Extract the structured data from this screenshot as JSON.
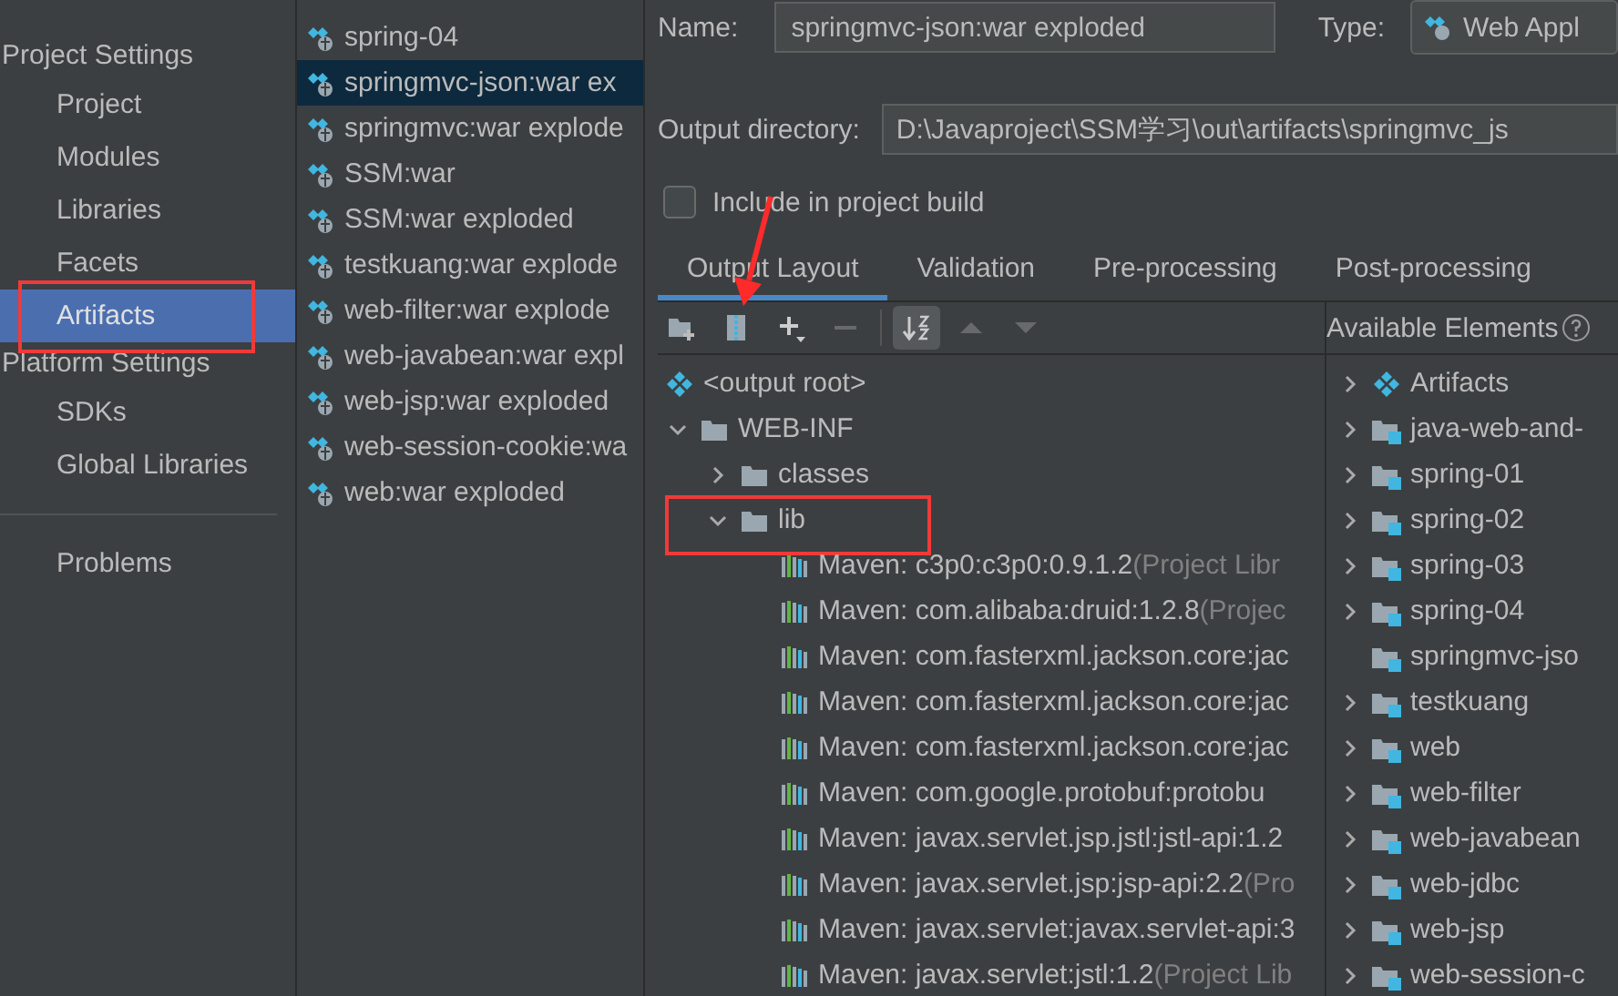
{
  "nav": [
    {
      "kind": "header",
      "label": "Project Settings"
    },
    {
      "kind": "item",
      "label": "Project",
      "selected": false,
      "highlighted": false
    },
    {
      "kind": "item",
      "label": "Modules",
      "selected": false,
      "highlighted": false
    },
    {
      "kind": "item",
      "label": "Libraries",
      "selected": false,
      "highlighted": false
    },
    {
      "kind": "item",
      "label": "Facets",
      "selected": false,
      "highlighted": false
    },
    {
      "kind": "item",
      "label": "Artifacts",
      "selected": true,
      "highlighted": true
    },
    {
      "kind": "header",
      "label": "Platform Settings"
    },
    {
      "kind": "item",
      "label": "SDKs",
      "selected": false,
      "highlighted": false
    },
    {
      "kind": "item",
      "label": "Global Libraries",
      "selected": false,
      "highlighted": false
    },
    {
      "kind": "separator"
    },
    {
      "kind": "item",
      "label": "Problems",
      "selected": false,
      "highlighted": false
    }
  ],
  "artifacts": [
    {
      "label": "spring-04",
      "selected": false
    },
    {
      "label": "springmvc-json:war ex",
      "selected": true
    },
    {
      "label": "springmvc:war explode",
      "selected": false
    },
    {
      "label": "SSM:war",
      "selected": false
    },
    {
      "label": "SSM:war exploded",
      "selected": false
    },
    {
      "label": "testkuang:war explode",
      "selected": false
    },
    {
      "label": "web-filter:war explode",
      "selected": false
    },
    {
      "label": "web-javabean:war expl",
      "selected": false
    },
    {
      "label": "web-jsp:war exploded",
      "selected": false
    },
    {
      "label": "web-session-cookie:wa",
      "selected": false
    },
    {
      "label": "web:war exploded",
      "selected": false
    }
  ],
  "name": {
    "label": "Name:",
    "value": "springmvc-json:war exploded"
  },
  "type": {
    "label": "Type:",
    "value": "Web Appl"
  },
  "output_directory": {
    "label": "Output directory:",
    "value": "D:\\Javaproject\\SSM学习\\out\\artifacts\\springmvc_js"
  },
  "include_in_build": {
    "label": "Include in project build",
    "checked": false
  },
  "tabs": [
    {
      "label": "Output Layout",
      "selected": true
    },
    {
      "label": "Validation",
      "selected": false
    },
    {
      "label": "Pre-processing",
      "selected": false
    },
    {
      "label": "Post-processing",
      "selected": false
    }
  ],
  "toolbar": [
    {
      "kind": "new-folder",
      "disabled": false,
      "on": false
    },
    {
      "kind": "archive",
      "disabled": false,
      "on": false,
      "pointed": true
    },
    {
      "kind": "add",
      "disabled": false,
      "on": false
    },
    {
      "kind": "remove",
      "disabled": true,
      "on": false
    },
    {
      "kind": "separator"
    },
    {
      "kind": "sort",
      "disabled": false,
      "on": true
    },
    {
      "kind": "up",
      "disabled": true,
      "on": false
    },
    {
      "kind": "down",
      "disabled": true,
      "on": false
    }
  ],
  "available_elements": {
    "label": "Available Elements"
  },
  "output_tree": [
    {
      "kind": "root",
      "label": "<output root>"
    },
    {
      "kind": "folder",
      "label": "WEB-INF",
      "expanded": true,
      "children": [
        {
          "kind": "folder",
          "label": "classes",
          "expanded": false
        },
        {
          "kind": "folder",
          "label": "lib",
          "expanded": true,
          "highlighted": true,
          "children": [
            {
              "kind": "library",
              "label": "Maven: c3p0:c3p0:0.9.1.2",
              "note": "(Project Libr"
            },
            {
              "kind": "library",
              "label": "Maven: com.alibaba:druid:1.2.8",
              "note": "(Projec"
            },
            {
              "kind": "library",
              "label": "Maven: com.fasterxml.jackson.core:jac"
            },
            {
              "kind": "library",
              "label": "Maven: com.fasterxml.jackson.core:jac"
            },
            {
              "kind": "library",
              "label": "Maven: com.fasterxml.jackson.core:jac"
            },
            {
              "kind": "library",
              "label": "Maven: com.google.protobuf:protobu"
            },
            {
              "kind": "library",
              "label": "Maven: javax.servlet.jsp.jstl:jstl-api:1.2"
            },
            {
              "kind": "library",
              "label": "Maven: javax.servlet.jsp:jsp-api:2.2",
              "note": "(Pro"
            },
            {
              "kind": "library",
              "label": "Maven: javax.servlet:javax.servlet-api:3"
            },
            {
              "kind": "library",
              "label": "Maven: javax.servlet:jstl:1.2",
              "note": "(Project Lib"
            }
          ]
        }
      ]
    }
  ],
  "available": [
    {
      "kind": "artifacts",
      "label": "Artifacts",
      "expandable": true
    },
    {
      "kind": "module",
      "label": "java-web-and-",
      "expandable": true
    },
    {
      "kind": "module",
      "label": "spring-01",
      "expandable": true
    },
    {
      "kind": "module",
      "label": "spring-02",
      "expandable": true
    },
    {
      "kind": "module",
      "label": "spring-03",
      "expandable": true
    },
    {
      "kind": "module",
      "label": "spring-04",
      "expandable": true
    },
    {
      "kind": "module",
      "label": "springmvc-jso",
      "expandable": false
    },
    {
      "kind": "module",
      "label": "testkuang",
      "expandable": true
    },
    {
      "kind": "module",
      "label": "web",
      "expandable": true
    },
    {
      "kind": "module",
      "label": "web-filter",
      "expandable": true
    },
    {
      "kind": "module",
      "label": "web-javabean",
      "expandable": true
    },
    {
      "kind": "module",
      "label": "web-jdbc",
      "expandable": true
    },
    {
      "kind": "module",
      "label": "web-jsp",
      "expandable": true
    },
    {
      "kind": "module",
      "label": "web-session-c",
      "expandable": true
    }
  ]
}
